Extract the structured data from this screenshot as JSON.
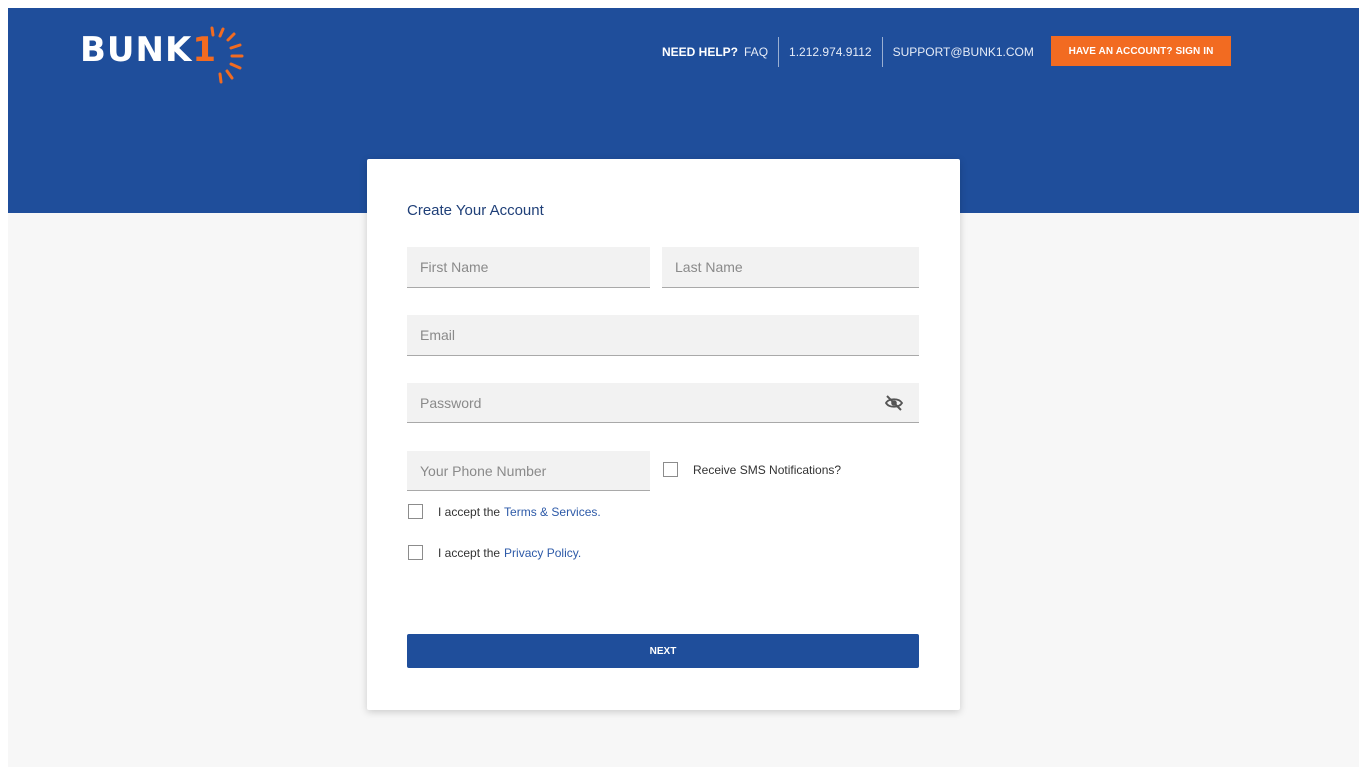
{
  "header": {
    "logo_text": "BUNK",
    "logo_digit": "1",
    "need_help_label": "NEED HELP?",
    "faq_label": "FAQ",
    "phone": "1.212.974.9112",
    "email": "SUPPORT@BUNK1.COM",
    "signin_label": "HAVE AN ACCOUNT? SIGN IN"
  },
  "form": {
    "title": "Create Your Account",
    "first_name_placeholder": "First Name",
    "last_name_placeholder": "Last Name",
    "email_placeholder": "Email",
    "password_placeholder": "Password",
    "phone_placeholder": "Your Phone Number",
    "sms_label": "Receive SMS Notifications?",
    "terms_prefix": "I accept the",
    "terms_link": "Terms & Services.",
    "privacy_prefix": "I accept the",
    "privacy_link": "Privacy Policy.",
    "next_label": "NEXT"
  },
  "icons": {
    "password_toggle": "eye-slash-icon",
    "logo_rays": "sunburst-icon"
  },
  "colors": {
    "brand_blue": "#1f4e9b",
    "accent_orange": "#f26b21",
    "link_blue": "#2d5aa8"
  }
}
